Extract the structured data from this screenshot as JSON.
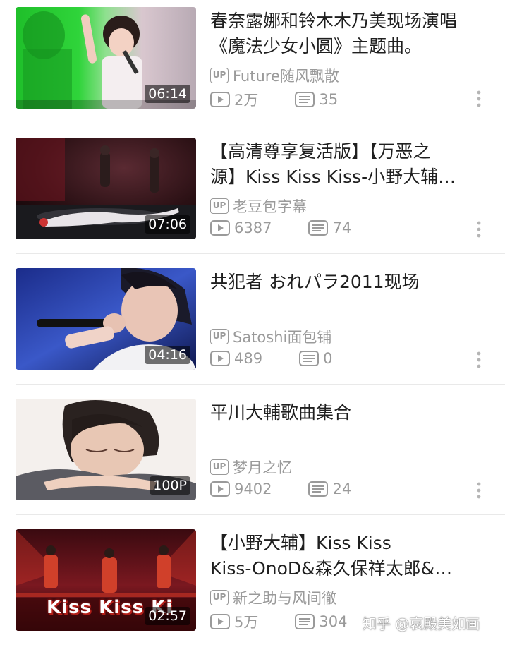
{
  "videos": [
    {
      "title_lines": [
        "春奈露娜和铃木木乃美现场演唱",
        "《魔法少女小圆》主题曲。"
      ],
      "duration": "06:14",
      "uploader": "Future随风飘散",
      "views": "2万",
      "danmaku": "35",
      "thumb_theme": "green-stage-concert"
    },
    {
      "title_lines": [
        "【高清尊享复活版】【万恶之",
        "源】Kiss Kiss Kiss-小野大辅…"
      ],
      "duration": "07:06",
      "uploader": "老豆包字幕",
      "views": "6387",
      "danmaku": "74",
      "thumb_theme": "dark-stage-dancers"
    },
    {
      "title_lines": [
        "共犯者 おれパラ2011现场"
      ],
      "duration": "04:16",
      "uploader": "Satoshi面包铺",
      "views": "489",
      "danmaku": "0",
      "thumb_theme": "blue-singer-mic"
    },
    {
      "title_lines": [
        "平川大輔歌曲集合"
      ],
      "duration": "100P",
      "uploader": "梦月之忆",
      "views": "9402",
      "danmaku": "24",
      "thumb_theme": "portrait-resting"
    },
    {
      "title_lines": [
        "【小野大辅】Kiss Kiss",
        "Kiss-OnoD&森久保祥太郎&…"
      ],
      "duration": "02:57",
      "uploader": "新之助与风间徹",
      "views": "5万",
      "danmaku": "304",
      "thumb_theme": "red-stage-kisskiss",
      "thumb_overlay_text": "Kiss Kiss Ki"
    }
  ],
  "labels": {
    "up_badge": "UP"
  },
  "icons": {
    "views": "play-icon",
    "danmaku": "danmaku-icon",
    "more": "more-vertical-icon"
  },
  "watermark": "知乎 @哀殿美如画",
  "colors": {
    "meta_gray": "#9a9a9a",
    "title_text": "#1f1f1f",
    "divider": "#e9e9e9"
  }
}
